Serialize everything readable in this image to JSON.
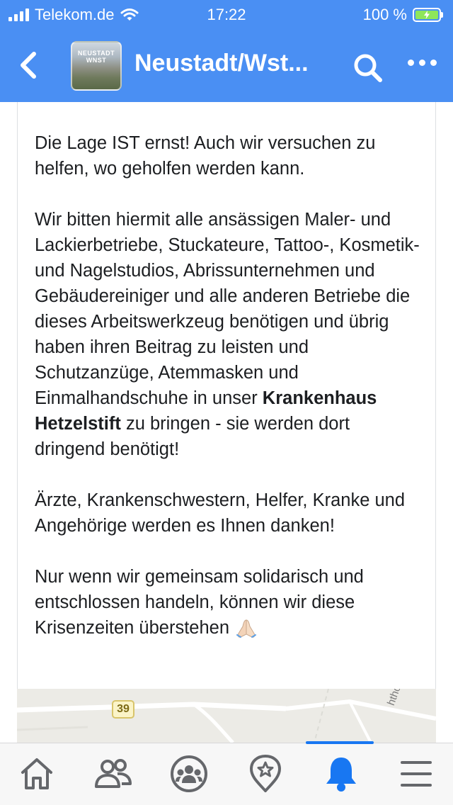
{
  "status_bar": {
    "carrier": "Telekom.de",
    "time": "17:22",
    "battery": "100 %"
  },
  "nav": {
    "title": "Neustadt/Wst...",
    "thumb_logo": "NEUSTADT WNST"
  },
  "post": {
    "paragraphs": [
      "Die Lage IST ernst! Auch wir versuchen zu helfen, wo geholfen werden kann.",
      "Ärzte, Krankenschwestern, Helfer, Kranke und Angehörige werden es Ihnen danken!"
    ],
    "p2_before": "Wir bitten hiermit alle ansässigen Maler- und Lackierbetriebe, Stuckateure, Tattoo-, Kosmetik- und Nagelstudios, Abrissunternehmen und Gebäudereiniger und alle anderen Betriebe die dieses Arbeitswerkzeug benötigen und übrig haben ihren Beitrag zu leisten und Schutzanzüge, Atemmasken und Einmalhandschuhe in unser ",
    "p2_bold": "Krankenhaus Hetzelstift",
    "p2_after": " zu bringen - sie werden dort dringend benötigt!",
    "p4": "Nur wenn wir gemeinsam solidarisch und entschlossen handeln, können wir diese Krisenzeiten überstehen"
  },
  "map": {
    "road_number": "39",
    "street_fragment": "hthofstr"
  },
  "tabbar": {
    "active_tab": "notifications",
    "accent_color": "#1877f2",
    "tabs": [
      "home-icon",
      "friends-icon",
      "groups-icon",
      "pages-icon",
      "notifications-bell-icon",
      "menu-icon"
    ]
  },
  "colors": {
    "header": "#4a8ff3",
    "text": "#1c1e21",
    "battery": "#8ee65a"
  }
}
